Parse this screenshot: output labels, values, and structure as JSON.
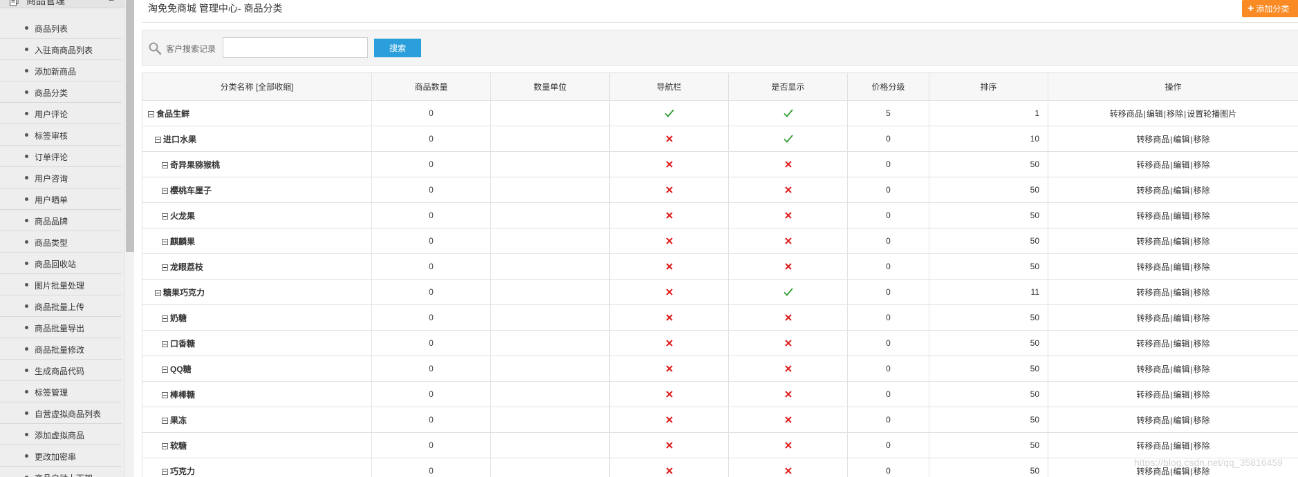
{
  "sidebar": {
    "header_label": "商品管理",
    "collapse_glyph": "−",
    "items": [
      {
        "label": "商品列表"
      },
      {
        "label": "入驻商商品列表"
      },
      {
        "label": "添加新商品"
      },
      {
        "label": "商品分类"
      },
      {
        "label": "用户评论"
      },
      {
        "label": "标签审核"
      },
      {
        "label": "订单评论"
      },
      {
        "label": "用户咨询"
      },
      {
        "label": "用户晒单"
      },
      {
        "label": "商品品牌"
      },
      {
        "label": "商品类型"
      },
      {
        "label": "商品回收站"
      },
      {
        "label": "图片批量处理"
      },
      {
        "label": "商品批量上传"
      },
      {
        "label": "商品批量导出"
      },
      {
        "label": "商品批量修改"
      },
      {
        "label": "生成商品代码"
      },
      {
        "label": "标签管理"
      },
      {
        "label": "自营虚拟商品列表"
      },
      {
        "label": "添加虚拟商品"
      },
      {
        "label": "更改加密串"
      },
      {
        "label": "商品自动上下架"
      }
    ]
  },
  "header": {
    "title": "淘免免商城 管理中心- 商品分类",
    "add_button_label": "添加分类",
    "add_button_icon": "+"
  },
  "search": {
    "label": "客户搜索记录",
    "input_value": "",
    "button_label": "搜索"
  },
  "table": {
    "columns": [
      "分类名称 [全部收缩]",
      "商品数量",
      "数量单位",
      "导航栏",
      "是否显示",
      "价格分级",
      "排序",
      "操作"
    ],
    "rows": [
      {
        "name": "食品生鲜",
        "level": 0,
        "count": "0",
        "unit": "",
        "nav": true,
        "show": true,
        "grade": "5",
        "sort": "1",
        "ops": [
          "转移商品",
          "编辑",
          "移除",
          "设置轮播图片"
        ]
      },
      {
        "name": "进口水果",
        "level": 1,
        "count": "0",
        "unit": "",
        "nav": false,
        "show": true,
        "grade": "0",
        "sort": "10",
        "ops": [
          "转移商品",
          "编辑",
          "移除"
        ]
      },
      {
        "name": "奇异果猕猴桃",
        "level": 2,
        "count": "0",
        "unit": "",
        "nav": false,
        "show": false,
        "grade": "0",
        "sort": "50",
        "ops": [
          "转移商品",
          "编辑",
          "移除"
        ]
      },
      {
        "name": "樱桃车厘子",
        "level": 2,
        "count": "0",
        "unit": "",
        "nav": false,
        "show": false,
        "grade": "0",
        "sort": "50",
        "ops": [
          "转移商品",
          "编辑",
          "移除"
        ]
      },
      {
        "name": "火龙果",
        "level": 2,
        "count": "0",
        "unit": "",
        "nav": false,
        "show": false,
        "grade": "0",
        "sort": "50",
        "ops": [
          "转移商品",
          "编辑",
          "移除"
        ]
      },
      {
        "name": "麒麟果",
        "level": 2,
        "count": "0",
        "unit": "",
        "nav": false,
        "show": false,
        "grade": "0",
        "sort": "50",
        "ops": [
          "转移商品",
          "编辑",
          "移除"
        ]
      },
      {
        "name": "龙眼荔枝",
        "level": 2,
        "count": "0",
        "unit": "",
        "nav": false,
        "show": false,
        "grade": "0",
        "sort": "50",
        "ops": [
          "转移商品",
          "编辑",
          "移除"
        ]
      },
      {
        "name": "糖果巧克力",
        "level": 1,
        "count": "0",
        "unit": "",
        "nav": false,
        "show": true,
        "grade": "0",
        "sort": "11",
        "ops": [
          "转移商品",
          "编辑",
          "移除"
        ]
      },
      {
        "name": "奶糖",
        "level": 2,
        "count": "0",
        "unit": "",
        "nav": false,
        "show": false,
        "grade": "0",
        "sort": "50",
        "ops": [
          "转移商品",
          "编辑",
          "移除"
        ]
      },
      {
        "name": "口香糖",
        "level": 2,
        "count": "0",
        "unit": "",
        "nav": false,
        "show": false,
        "grade": "0",
        "sort": "50",
        "ops": [
          "转移商品",
          "编辑",
          "移除"
        ]
      },
      {
        "name": "QQ糖",
        "level": 2,
        "count": "0",
        "unit": "",
        "nav": false,
        "show": false,
        "grade": "0",
        "sort": "50",
        "ops": [
          "转移商品",
          "编辑",
          "移除"
        ]
      },
      {
        "name": "棒棒糖",
        "level": 2,
        "count": "0",
        "unit": "",
        "nav": false,
        "show": false,
        "grade": "0",
        "sort": "50",
        "ops": [
          "转移商品",
          "编辑",
          "移除"
        ]
      },
      {
        "name": "果冻",
        "level": 2,
        "count": "0",
        "unit": "",
        "nav": false,
        "show": false,
        "grade": "0",
        "sort": "50",
        "ops": [
          "转移商品",
          "编辑",
          "移除"
        ]
      },
      {
        "name": "软糖",
        "level": 2,
        "count": "0",
        "unit": "",
        "nav": false,
        "show": false,
        "grade": "0",
        "sort": "50",
        "ops": [
          "转移商品",
          "编辑",
          "移除"
        ]
      },
      {
        "name": "巧克力",
        "level": 2,
        "count": "0",
        "unit": "",
        "nav": false,
        "show": false,
        "grade": "0",
        "sort": "50",
        "ops": [
          "转移商品",
          "编辑",
          "移除"
        ]
      }
    ]
  },
  "watermark": "https://blog.csdn.net/qq_35816459",
  "colors": {
    "check": "#2e9b2e",
    "cross": "#e01c1c",
    "search_button": "#2b9fdb",
    "add_button": "#f98a24"
  }
}
